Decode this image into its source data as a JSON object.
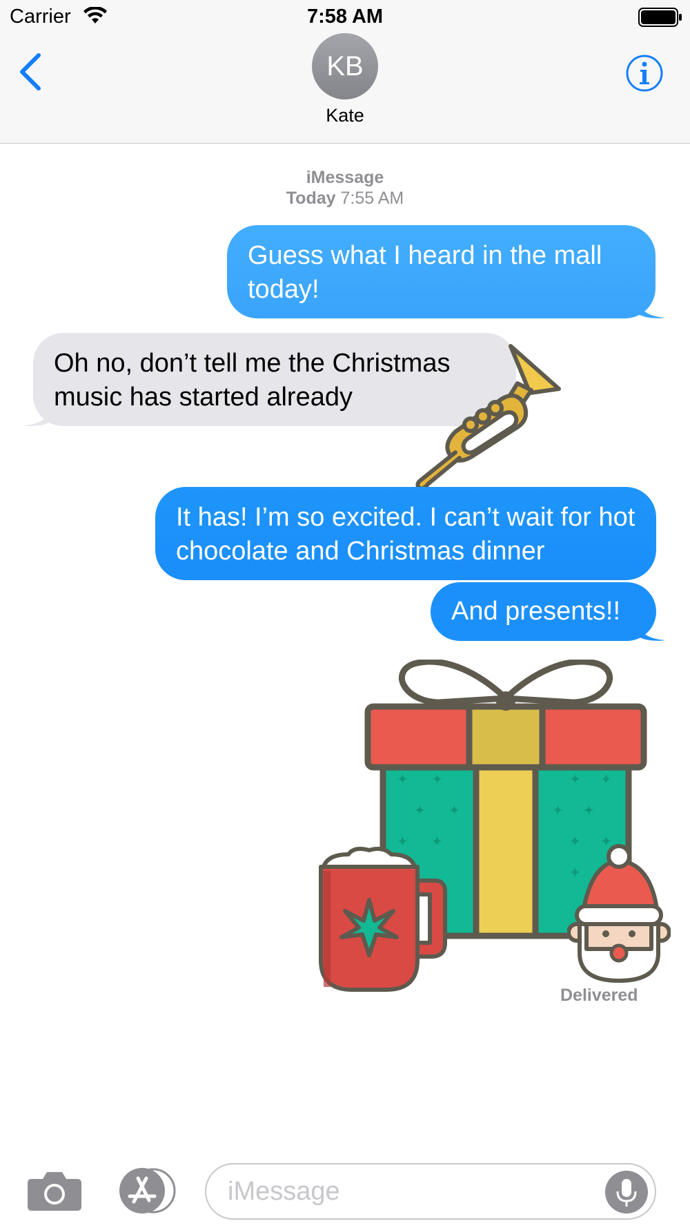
{
  "status_bar": {
    "carrier": "Carrier",
    "time": "7:58 AM"
  },
  "header": {
    "avatar_initials": "KB",
    "contact_name": "Kate"
  },
  "thread": {
    "service": "iMessage",
    "timestamp_day": "Today",
    "timestamp_time": "7:55 AM",
    "messages": [
      {
        "direction": "outgoing",
        "text": "Guess what I heard in the mall today!"
      },
      {
        "direction": "incoming",
        "text": "Oh no, don’t tell me the Christmas music has started already"
      },
      {
        "direction": "outgoing",
        "text": "It has! I’m so excited. I can’t wait for hot chocolate and Christmas dinner"
      },
      {
        "direction": "outgoing",
        "text": "And presents!!"
      }
    ],
    "stickers": [
      "trumpet-sticker",
      "gift-box-sticker",
      "hot-chocolate-mug-sticker",
      "santa-sticker"
    ],
    "delivery_status": "Delivered"
  },
  "composer": {
    "placeholder": "iMessage"
  },
  "icons": [
    "back-chevron-icon",
    "info-icon",
    "wifi-icon",
    "battery-icon",
    "camera-icon",
    "app-store-icon",
    "microphone-icon"
  ],
  "colors": {
    "outgoing_bubble": "#1c90fa",
    "incoming_bubble": "#e5e5ea",
    "accent": "#147efb"
  }
}
